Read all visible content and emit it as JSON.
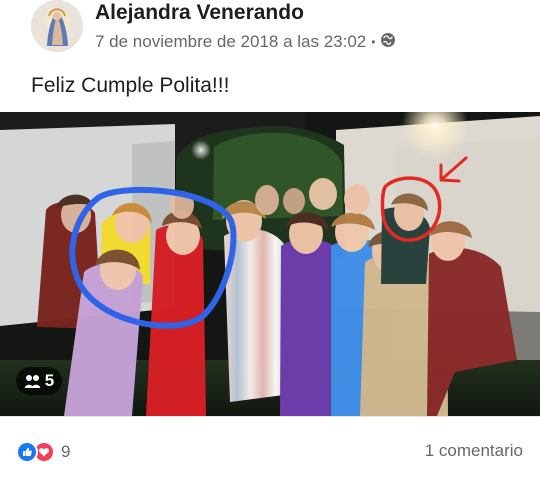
{
  "post": {
    "author": "Alejandra Venerando",
    "timestamp": "7 de noviembre de 2018 a las 23:02",
    "separator": "•",
    "privacy_icon": "globe-icon",
    "message": "Feliz Cumple Polita!!!"
  },
  "photo": {
    "tagged_people_count": "5",
    "people_icon": "people-icon",
    "annotations": {
      "blue_circle_color": "#2f63e8",
      "red_circle_color": "#e22a24",
      "arrow_color": "#e22a24"
    }
  },
  "footer": {
    "reaction_icons": [
      "like-icon",
      "love-icon"
    ],
    "reaction_count": "9",
    "comments_text": "1 comentario"
  },
  "colors": {
    "text_primary": "#1c1e21",
    "text_secondary": "#65676b",
    "like_blue": "#1877f2",
    "love_red": "#f33e58"
  }
}
